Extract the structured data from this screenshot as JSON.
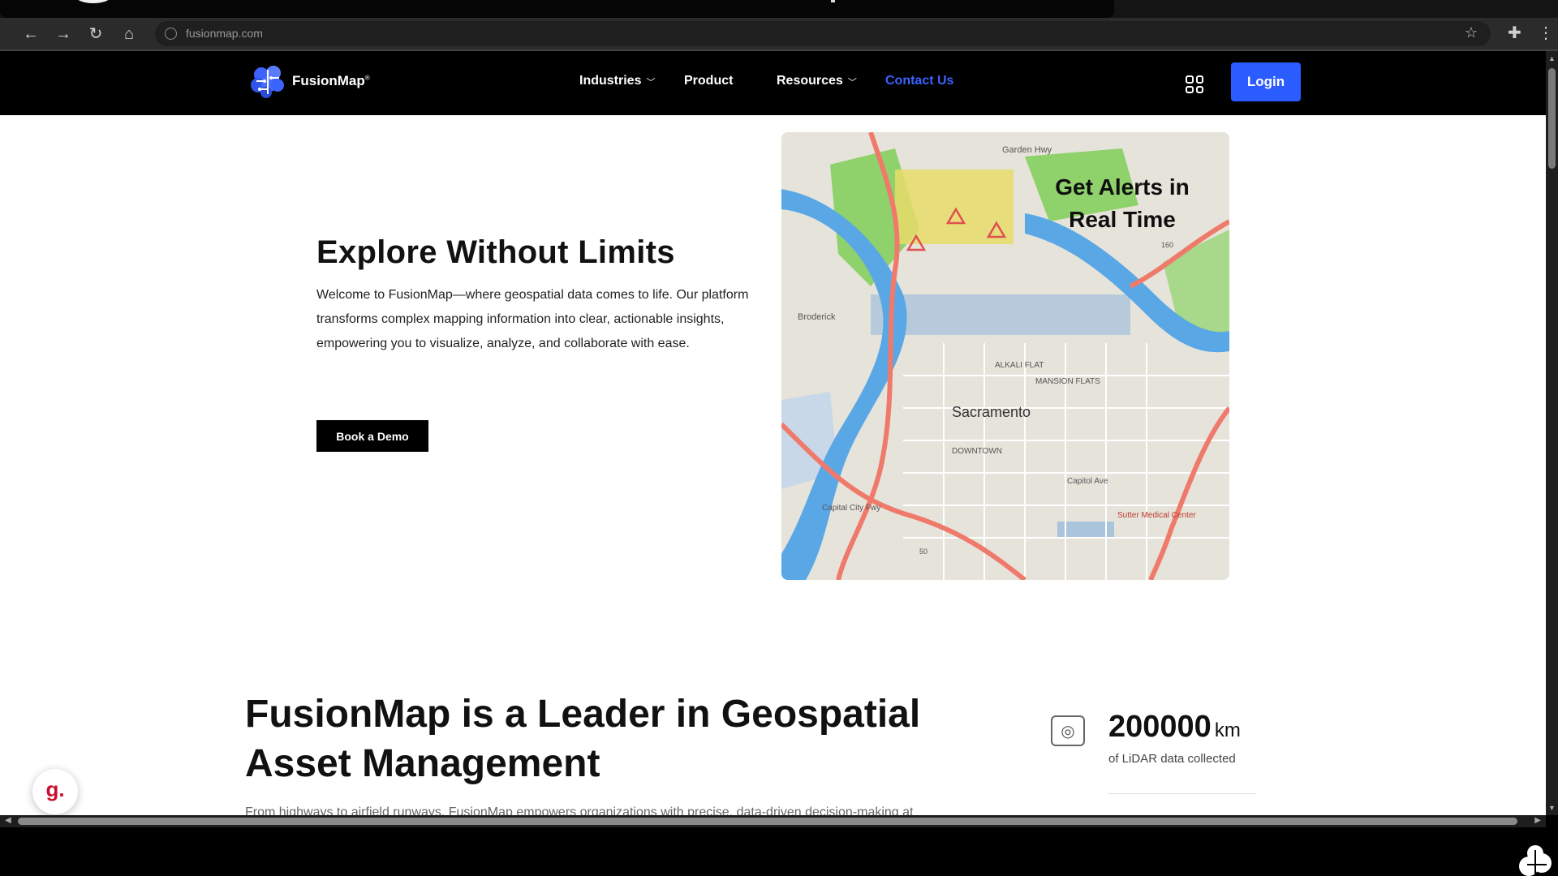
{
  "browser": {
    "url": "fusionmap.com",
    "icons": [
      "back-icon",
      "forward-icon",
      "reload-icon",
      "home-icon",
      "site-info-icon",
      "bookmark-star-icon",
      "extensions-icon",
      "menu-icon"
    ]
  },
  "header": {
    "brand": "FusionMap",
    "brand_mark": "®",
    "nav": [
      {
        "label": "Industries",
        "has_dropdown": true
      },
      {
        "label": "Product",
        "has_dropdown": false
      },
      {
        "label": "Resources",
        "has_dropdown": true
      },
      {
        "label": "Contact Us",
        "has_dropdown": false,
        "active": true
      }
    ],
    "login_label": "Login",
    "accent_color": "#2b5cff"
  },
  "hero": {
    "title": "Explore Without Limits",
    "text": "Welcome to FusionMap—where geospatial data comes to life. Our platform transforms complex mapping information into clear, actionable insights, empowering you to visualize, analyze, and collaborate with ease.",
    "cta_label": "Book a Demo"
  },
  "map_card": {
    "overlay_title": "Get Alerts in Real Time",
    "city": "Sacramento",
    "labels": [
      "Garden Hwy",
      "Broderick",
      "ALKALI FLAT",
      "MANSION FLATS",
      "DOWNTOWN",
      "Capitol Ave",
      "Sutter Medical Center",
      "Capital City Fwy",
      "160",
      "50"
    ]
  },
  "leader": {
    "title": "FusionMap is a Leader in Geospatial Asset Management",
    "text": "From highways to airfield runways, FusionMap empowers organizations with precise, data-driven decision-making at"
  },
  "stat": {
    "value": "200000",
    "unit": "km",
    "label": "of LiDAR data collected"
  },
  "chat_widget": {
    "glyph": "g."
  }
}
